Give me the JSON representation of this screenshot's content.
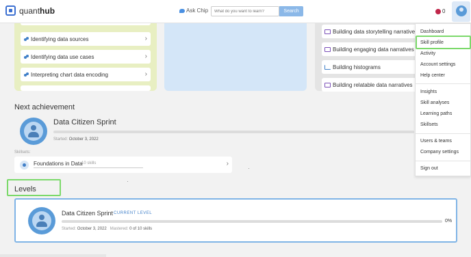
{
  "header": {
    "logo_text_light": "quant",
    "logo_text_bold": "hub",
    "ask_chip_label": "Ask Chip",
    "search_placeholder": "What do you want to learn?",
    "search_button": "Search",
    "notification_count": "0",
    "accent_color": "#3b6fd1"
  },
  "panels": {
    "left_items": [
      {
        "label": "Identifying data sources"
      },
      {
        "label": "Identifying data use cases"
      },
      {
        "label": "Interpreting chart data encoding"
      }
    ],
    "right_items": [
      {
        "label": "Building data storytelling narratives"
      },
      {
        "label": "Building engaging data narratives"
      },
      {
        "label": "Building histograms"
      },
      {
        "label": "Building relatable data narratives"
      }
    ]
  },
  "next_achievement": {
    "section_title": "Next achievement",
    "name": "Data Citizen Sprint",
    "started_label": "Started:",
    "started_date": "October 3, 2022",
    "skillsets_label": "Skillsets:",
    "skillset_name": "Foundations in Data",
    "skillset_count": "10 skills"
  },
  "levels": {
    "section_title": "Levels",
    "name": "Data Citizen Sprint",
    "tag": "CURRENT LEVEL",
    "progress_pct": "0%",
    "progress_value": 0,
    "started_label": "Started:",
    "started_date": "October 3, 2022",
    "mastered_label": "Mastered:",
    "mastered_value": "0 of 10 skills"
  },
  "dropdown": {
    "items": [
      "Dashboard",
      "Skill profile",
      "Activity",
      "Account settings",
      "Help center",
      "Insights",
      "Skill analyses",
      "Learning paths",
      "Skillsets",
      "Users & teams",
      "Company settings",
      "Sign out"
    ]
  },
  "colors": {
    "highlight": "#7bd96a",
    "level_border": "#7fb4e6",
    "brand_blue": "#5a9bd8"
  }
}
